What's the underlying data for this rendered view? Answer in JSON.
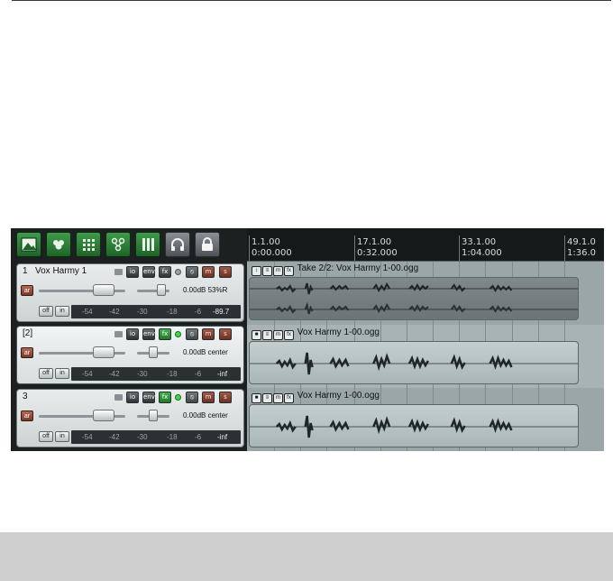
{
  "toolbar": {
    "buttons": [
      {
        "icon": "image-icon"
      },
      {
        "icon": "group-icon"
      },
      {
        "icon": "grid-icon"
      },
      {
        "icon": "routing-icon"
      },
      {
        "icon": "columns-icon"
      },
      {
        "icon": "headphones-icon"
      },
      {
        "icon": "lock-icon"
      }
    ]
  },
  "tracks": [
    {
      "number": "1",
      "name": "Vox Harmy 1",
      "io": "io",
      "env": "env",
      "fx": "fx",
      "mute": "m",
      "solo": "s",
      "arm": "ar",
      "readout": "0.00dB 53%R",
      "off": "off",
      "in": "in",
      "meter_scale": [
        "-54",
        "-42",
        "-30",
        "-18",
        "-6"
      ],
      "peak": "-89.7"
    },
    {
      "number": "[2]",
      "name": "",
      "io": "io",
      "env": "env",
      "fx": "fx",
      "mute": "m",
      "solo": "s",
      "arm": "ar",
      "readout": "0.00dB center",
      "off": "off",
      "in": "in",
      "meter_scale": [
        "-54",
        "-42",
        "-30",
        "-18",
        "-6"
      ],
      "peak": "-inf"
    },
    {
      "number": "3",
      "name": "",
      "io": "io",
      "env": "env",
      "fx": "fx",
      "mute": "m",
      "solo": "s",
      "arm": "ar",
      "readout": "0.00dB center",
      "off": "off",
      "in": "in",
      "meter_scale": [
        "-54",
        "-42",
        "-30",
        "-18",
        "-6"
      ],
      "peak": "-inf"
    }
  ],
  "ruler": {
    "markers": [
      {
        "measure": "1.1.00",
        "time": "0:00.000"
      },
      {
        "measure": "17.1.00",
        "time": "0:32.000"
      },
      {
        "measure": "33.1.00",
        "time": "1:04.000"
      },
      {
        "measure": "49.1.0",
        "time": "1:36.0"
      }
    ]
  },
  "items": [
    {
      "title": "Take 2/2: Vox Harmy 1-00.ogg"
    },
    {
      "title": "Vox Harmy 1-00.ogg"
    },
    {
      "title": "Vox Harmy 1-00.ogg"
    }
  ]
}
